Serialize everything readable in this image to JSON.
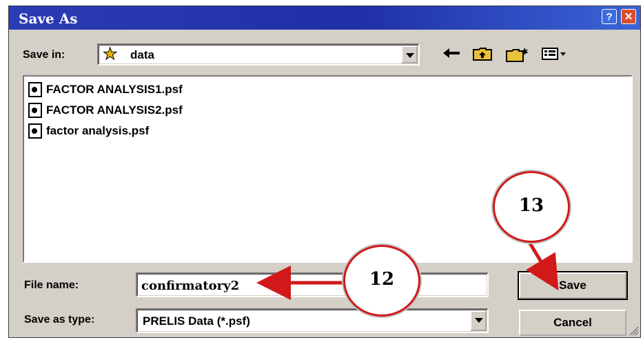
{
  "window": {
    "title": "Save As"
  },
  "titlebar": {
    "help_glyph": "?",
    "close_glyph": "✕"
  },
  "save_in": {
    "label": "Save in:",
    "value": "data"
  },
  "toolbar": {
    "back_icon": "back-arrow-icon",
    "up_icon": "up-folder-icon",
    "new_folder_icon": "new-folder-icon",
    "views_icon": "views-menu-icon"
  },
  "files": [
    {
      "name": "FACTOR ANALYSIS1.psf"
    },
    {
      "name": "FACTOR ANALYSIS2.psf"
    },
    {
      "name": "factor analysis.psf"
    }
  ],
  "file_name": {
    "label": "File name:",
    "value": "confirmatory2"
  },
  "save_as_type": {
    "label": "Save as type:",
    "value": "PRELIS Data (*.psf)"
  },
  "buttons": {
    "save": "Save",
    "cancel": "Cancel"
  },
  "annotations": {
    "callout_12": "12",
    "callout_13": "13"
  },
  "colors": {
    "titlebar": "#2c3cb5",
    "dialog": "#d4d0c8",
    "annotation": "#d11919"
  }
}
